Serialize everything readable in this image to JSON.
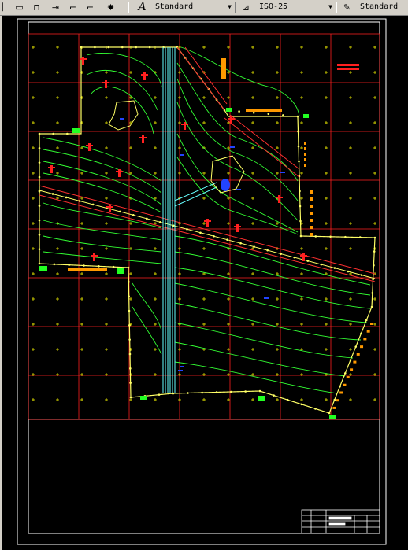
{
  "toolbar": {
    "text_style": "Standard",
    "dim_style": "ISO-25",
    "table_style": "Standard"
  },
  "colors": {
    "grid": "#ff0000",
    "contour": "#00ff00",
    "boundary": "#ffff66",
    "road": "#66ffff",
    "accent": "#ff9900",
    "frame": "#ffffff"
  }
}
